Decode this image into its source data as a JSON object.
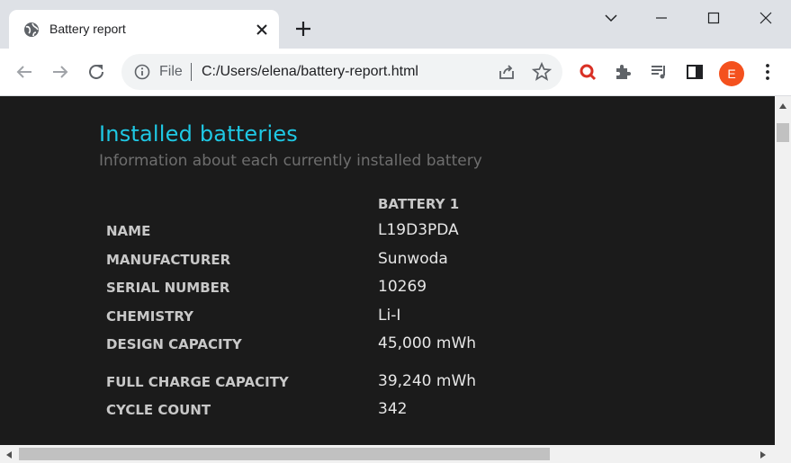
{
  "tab": {
    "title": "Battery report"
  },
  "omnibox": {
    "scheme_label": "File",
    "url": "C:/Users/elena/battery-report.html"
  },
  "profile": {
    "initial": "E",
    "color": "#f4511e"
  },
  "report": {
    "heading": "Installed batteries",
    "subheading": "Information about each currently installed battery",
    "column_header": "BATTERY 1",
    "rows": [
      {
        "label": "NAME",
        "value": "L19D3PDA"
      },
      {
        "label": "MANUFACTURER",
        "value": "Sunwoda"
      },
      {
        "label": "SERIAL NUMBER",
        "value": "10269"
      },
      {
        "label": "CHEMISTRY",
        "value": "Li-I"
      },
      {
        "label": "DESIGN CAPACITY",
        "value": "45,000 mWh"
      },
      {
        "label": "FULL CHARGE CAPACITY",
        "value": "39,240 mWh"
      },
      {
        "label": "CYCLE COUNT",
        "value": "342"
      }
    ]
  },
  "colors": {
    "heading": "#1fc8e4",
    "background": "#1b1b1b",
    "accent_icon": "#d93025"
  }
}
